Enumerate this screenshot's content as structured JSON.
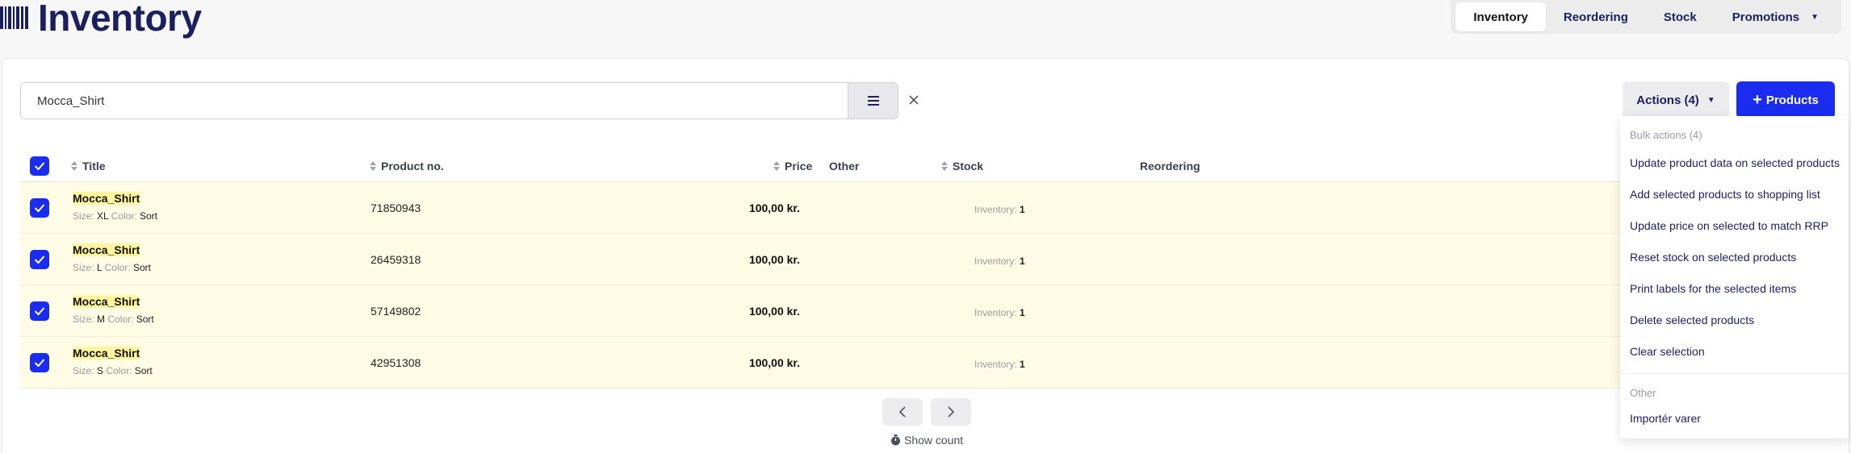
{
  "app": {
    "title": "Inventory"
  },
  "nav": {
    "tabs": [
      {
        "label": "Inventory",
        "active": true
      },
      {
        "label": "Reordering",
        "active": false
      },
      {
        "label": "Stock",
        "active": false
      },
      {
        "label": "Promotions",
        "active": false
      }
    ]
  },
  "search": {
    "value": "Mocca_Shirt",
    "placeholder": ""
  },
  "toolbar": {
    "actions_label": "Actions (4)",
    "add_label": "Products"
  },
  "table": {
    "columns": {
      "title": "Title",
      "product_no": "Product no.",
      "price": "Price",
      "other": "Other",
      "stock": "Stock",
      "reordering": "Reordering"
    },
    "rows": [
      {
        "title": "Mocca_Shirt",
        "size_label": "Size:",
        "size": "XL",
        "color_label": "Color:",
        "color": "Sort",
        "product_no": "71850943",
        "price": "100,00 kr.",
        "inventory_label": "Inventory:",
        "inventory": "1"
      },
      {
        "title": "Mocca_Shirt",
        "size_label": "Size:",
        "size": "L",
        "color_label": "Color:",
        "color": "Sort",
        "product_no": "26459318",
        "price": "100,00 kr.",
        "inventory_label": "Inventory:",
        "inventory": "1"
      },
      {
        "title": "Mocca_Shirt",
        "size_label": "Size:",
        "size": "M",
        "color_label": "Color:",
        "color": "Sort",
        "product_no": "57149802",
        "price": "100,00 kr.",
        "inventory_label": "Inventory:",
        "inventory": "1"
      },
      {
        "title": "Mocca_Shirt",
        "size_label": "Size:",
        "size": "S",
        "color_label": "Color:",
        "color": "Sort",
        "product_no": "42951308",
        "price": "100,00 kr.",
        "inventory_label": "Inventory:",
        "inventory": "1"
      }
    ]
  },
  "pagination": {
    "show_count_label": "Show count"
  },
  "dropdown": {
    "bulk_header": "Bulk actions (4)",
    "bulk_items": [
      "Update product data on selected products",
      "Add selected products to shopping list",
      "Update price on selected to match RRP",
      "Reset stock on selected products",
      "Print labels for the selected items",
      "Delete selected products",
      "Clear selection"
    ],
    "other_header": "Other",
    "other_items": [
      "Importér varer"
    ]
  },
  "colors": {
    "brand": "#1b1f5e",
    "primary": "#1a2cf0",
    "row_highlight": "#fefce4"
  },
  "icons": {
    "logo": "barcode-icon",
    "search_menu": "hamburger-icon",
    "clear": "close-icon",
    "prev": "chevron-left-icon",
    "next": "chevron-right-icon",
    "show_count": "stopwatch-icon"
  }
}
